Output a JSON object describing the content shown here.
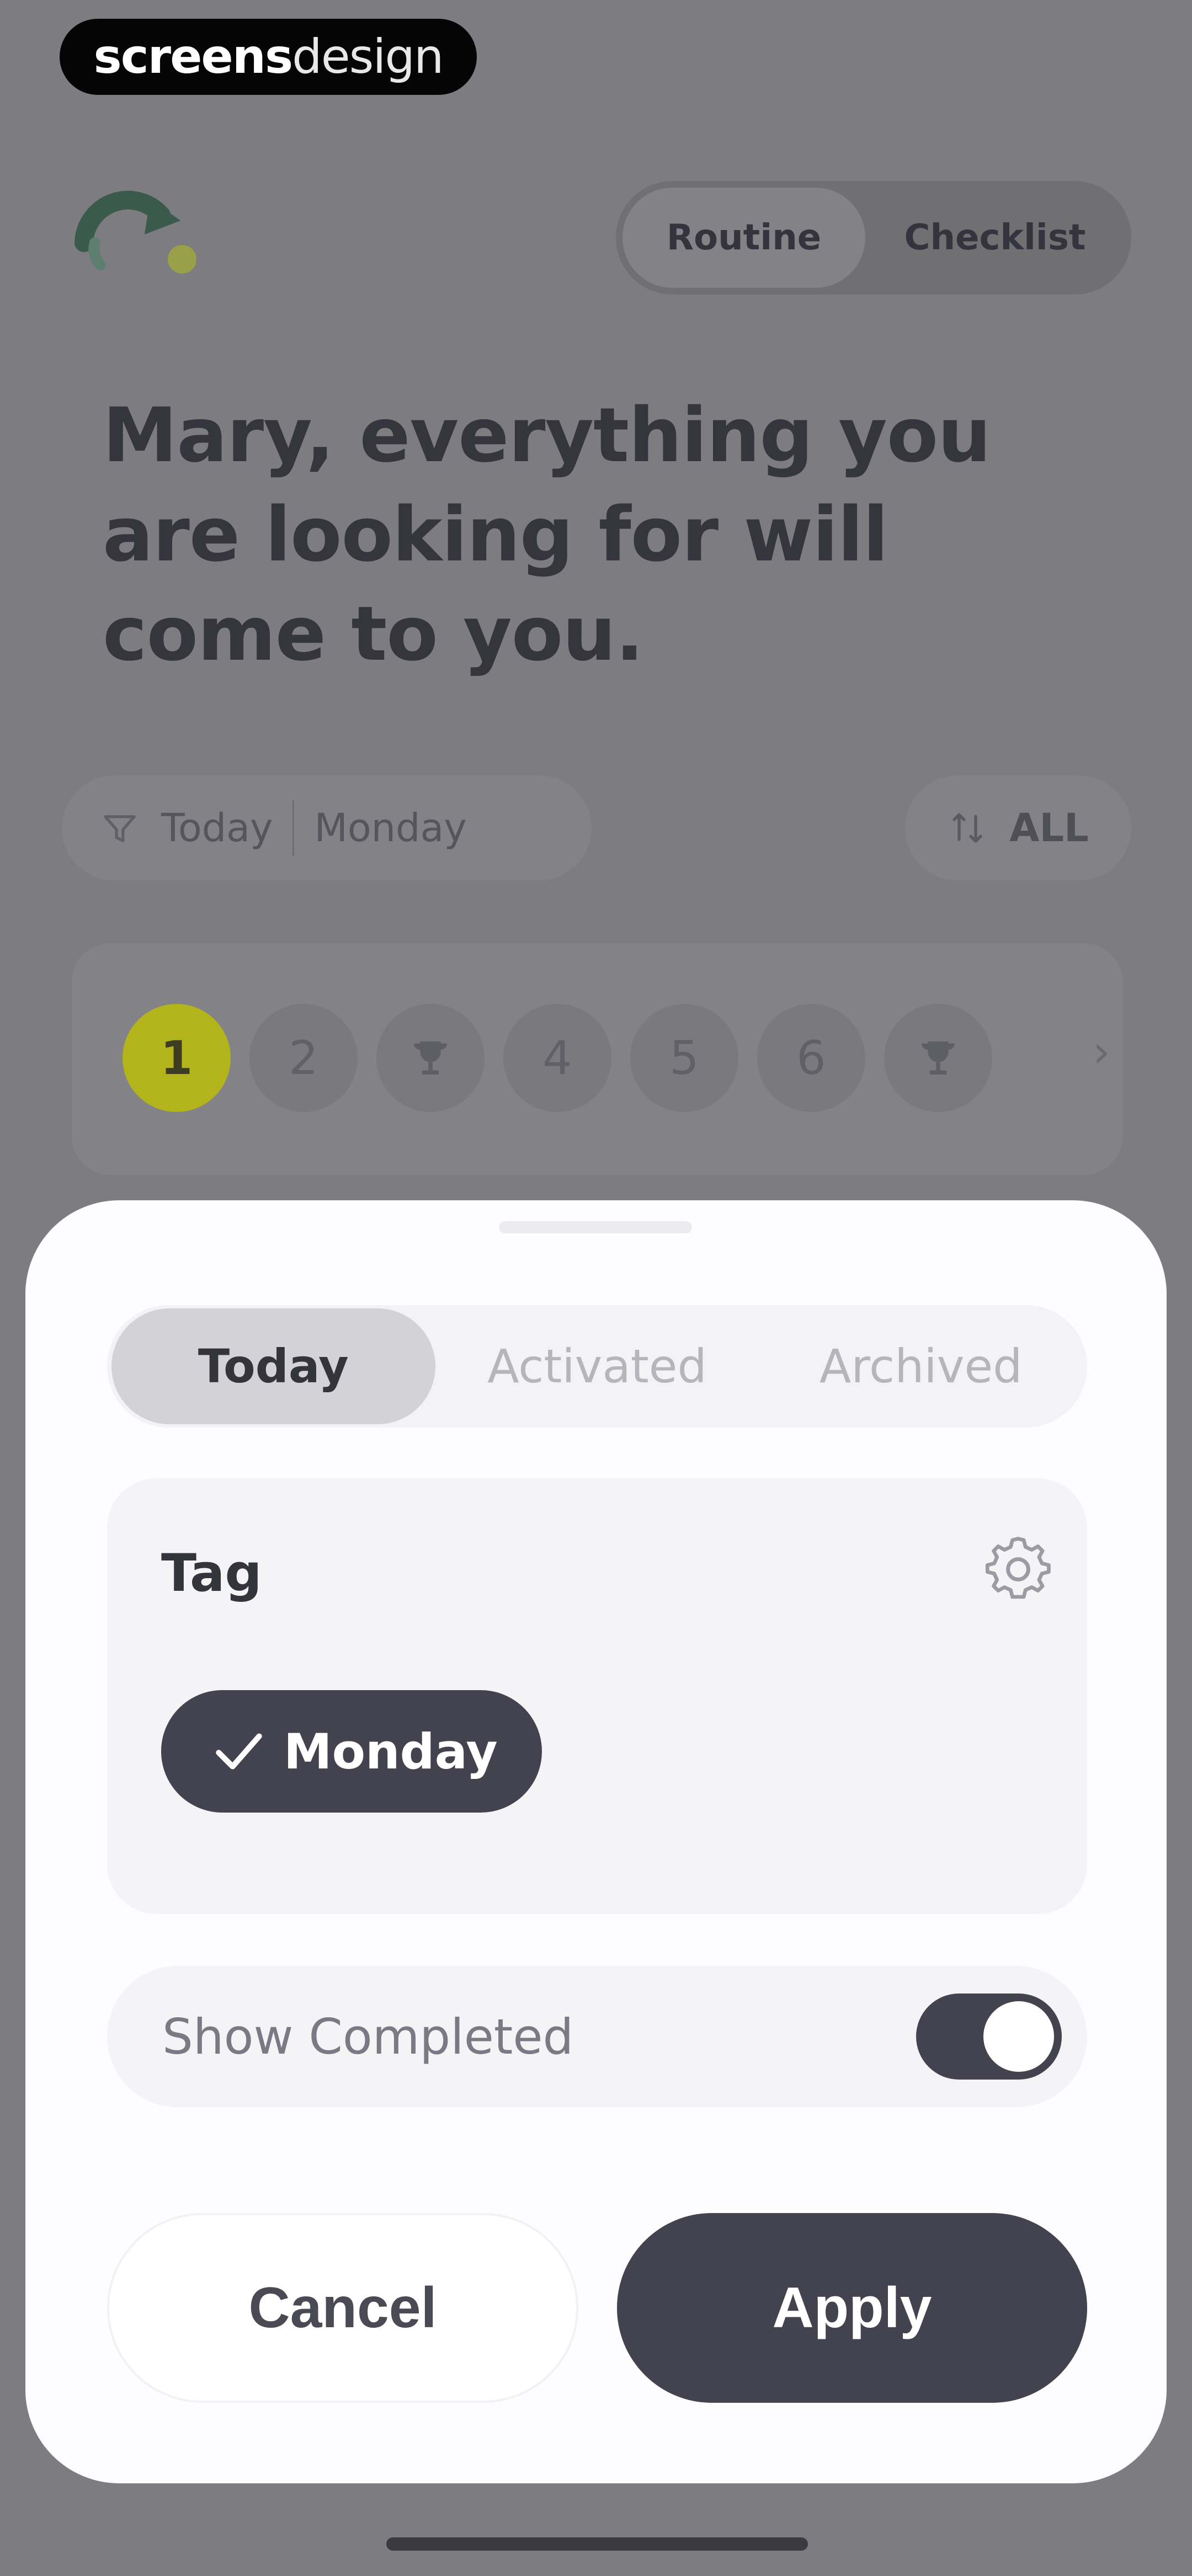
{
  "watermark": {
    "bold": "screens",
    "light": "design"
  },
  "header": {
    "mode_toggle": {
      "active": "Routine",
      "inactive": "Checklist"
    }
  },
  "quote": "Mary, everything you are looking for will come to you.",
  "filters": {
    "period": "Today",
    "tag": "Monday",
    "sort": "ALL"
  },
  "days": {
    "current": "1",
    "items": [
      "2",
      "4",
      "5",
      "6"
    ]
  },
  "sheet": {
    "tabs": [
      "Today",
      "Activated",
      "Archived"
    ],
    "active_tab": "Today",
    "tag_section": {
      "title": "Tag",
      "selected_tag": "Monday"
    },
    "show_completed": {
      "label": "Show Completed",
      "on": true
    },
    "cancel_label": "Cancel",
    "apply_label": "Apply"
  },
  "colors": {
    "accent_dark": "#43424f",
    "today_marker": "#b3b31c",
    "overlay": "#7d7c80"
  }
}
